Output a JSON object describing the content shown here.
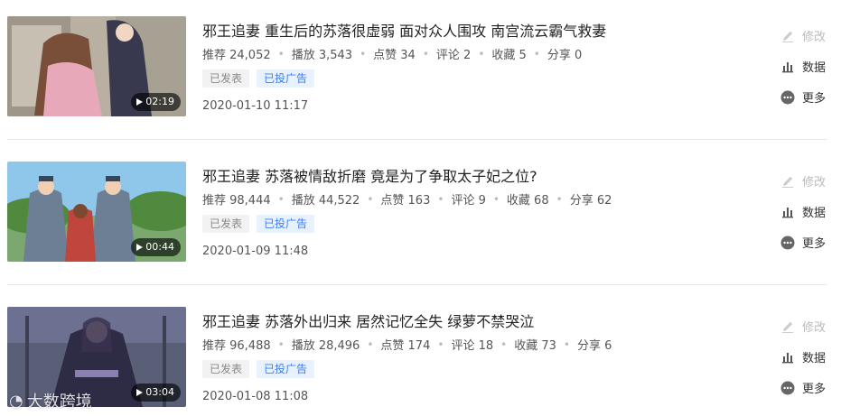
{
  "videos": [
    {
      "title": "邪王追妻 重生后的苏落很虚弱 面对众人围攻 南宫流云霸气救妻",
      "duration": "02:19",
      "stats": [
        "推荐 24,052",
        "播放 3,543",
        "点赞 34",
        "评论 2",
        "收藏 5",
        "分享 0"
      ],
      "tags": [
        "已发表",
        "已投广告"
      ],
      "date": "2020-01-10 11:17"
    },
    {
      "title": "邪王追妻 苏落被情敌折磨 竟是为了争取太子妃之位?",
      "duration": "00:44",
      "stats": [
        "推荐 98,444",
        "播放 44,522",
        "点赞 163",
        "评论 9",
        "收藏 68",
        "分享 62"
      ],
      "tags": [
        "已发表",
        "已投广告"
      ],
      "date": "2020-01-09 11:48"
    },
    {
      "title": "邪王追妻 苏落外出归来 居然记忆全失 绿萝不禁哭泣",
      "duration": "03:04",
      "stats": [
        "推荐 96,488",
        "播放 28,496",
        "点赞 174",
        "评论 18",
        "收藏 73",
        "分享 6"
      ],
      "tags": [
        "已发表",
        "已投广告"
      ],
      "date": "2020-01-08 11:08"
    }
  ],
  "actions": {
    "edit": "修改",
    "data": "数据",
    "more": "更多"
  },
  "icons": [
    "play-icon",
    "edit-icon",
    "bar-chart-icon",
    "more-icon"
  ],
  "watermark": "大数跨境",
  "colors": {
    "tag_blue": "#3d7ef0",
    "tag_blue_bg": "#e8f2ff",
    "disabled": "#bbbbbb"
  }
}
